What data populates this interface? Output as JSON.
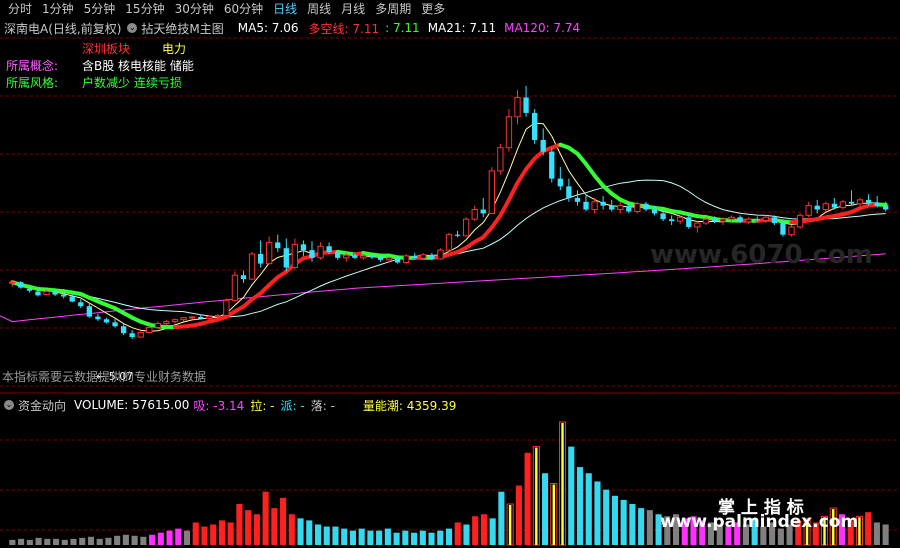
{
  "tabs": [
    {
      "label": "分时",
      "active": false
    },
    {
      "label": "1分钟",
      "active": false
    },
    {
      "label": "5分钟",
      "active": false
    },
    {
      "label": "15分钟",
      "active": false
    },
    {
      "label": "30分钟",
      "active": false
    },
    {
      "label": "60分钟",
      "active": false
    },
    {
      "label": "日线",
      "active": true
    },
    {
      "label": "周线",
      "active": false
    },
    {
      "label": "月线",
      "active": false
    },
    {
      "label": "多周期",
      "active": false
    },
    {
      "label": "更多",
      "active": false
    }
  ],
  "header": {
    "stock": "深南电A(日线,前复权)",
    "indicator": "拈天绝技M主图",
    "ma5": "MA5: 7.06",
    "duokong": "多空线: 7.11",
    "dk2": ": 7.11",
    "ma21": "MA21: 7.11",
    "ma120": "MA120: 7.74"
  },
  "info": {
    "board_value": "深圳板块",
    "industry_value": "电力",
    "concept_label": "所属概念:",
    "concept_value": "含B股 核电核能 储能",
    "style_label": "所属风格:",
    "style_value": "户数减少 连续亏损"
  },
  "notes": {
    "low_price": "← 5.07",
    "cloud_notice": "本指标需要云数据提供的专业财务数据"
  },
  "lower": {
    "name": "资金动向",
    "volume": "VOLUME: 57615.00",
    "xi": "吸: -3.14",
    "la": "拉: -",
    "pai": "派: -",
    "luo": "落: -",
    "liangnengchao": "量能潮: 4359.39"
  },
  "watermarks": {
    "cn": "掌 上 指 标",
    "url": "www.palmindex.com",
    "site": "www.6070.com"
  },
  "colors": {
    "up": "#ff3030",
    "down": "#36e0ff",
    "ma5": "#ffffa0",
    "ma21": "#c0ffff",
    "ma120": "#ff40ff",
    "dk_up": "#ff2020",
    "dk_down": "#33ff33",
    "grid": "#7a0000"
  },
  "chart_data": {
    "type": "candlestick",
    "candles": [
      [
        7.2,
        7.28,
        7.1,
        7.22,
        "up"
      ],
      [
        7.22,
        7.25,
        7.05,
        7.08,
        "down"
      ],
      [
        7.05,
        7.12,
        6.95,
        7.0,
        "down"
      ],
      [
        6.98,
        7.05,
        6.85,
        6.88,
        "down"
      ],
      [
        6.9,
        7.02,
        6.88,
        6.98,
        "up"
      ],
      [
        6.98,
        7.0,
        6.86,
        6.9,
        "down"
      ],
      [
        6.9,
        6.96,
        6.8,
        6.85,
        "down"
      ],
      [
        6.85,
        6.9,
        6.7,
        6.72,
        "down"
      ],
      [
        6.7,
        6.78,
        6.55,
        6.6,
        "down"
      ],
      [
        6.6,
        6.66,
        6.3,
        6.33,
        "down"
      ],
      [
        6.33,
        6.4,
        6.22,
        6.26,
        "down"
      ],
      [
        6.26,
        6.3,
        6.15,
        6.18,
        "down"
      ],
      [
        6.18,
        6.27,
        6.05,
        6.08,
        "down"
      ],
      [
        6.08,
        6.15,
        5.85,
        5.9,
        "down"
      ],
      [
        5.9,
        5.98,
        5.75,
        5.8,
        "down"
      ],
      [
        5.8,
        5.95,
        5.78,
        5.92,
        "up"
      ],
      [
        5.92,
        6.1,
        5.9,
        6.05,
        "up"
      ],
      [
        6.05,
        6.2,
        6.02,
        6.15,
        "up"
      ],
      [
        6.15,
        6.25,
        6.1,
        6.2,
        "up"
      ],
      [
        6.2,
        6.28,
        6.15,
        6.25,
        "up"
      ],
      [
        6.25,
        6.32,
        6.2,
        6.3,
        "up"
      ],
      [
        6.3,
        6.35,
        6.25,
        6.32,
        "up"
      ],
      [
        6.32,
        6.38,
        6.25,
        6.28,
        "down"
      ],
      [
        6.28,
        6.36,
        6.22,
        6.33,
        "up"
      ],
      [
        6.33,
        6.4,
        6.28,
        6.36,
        "up"
      ],
      [
        6.36,
        6.8,
        6.35,
        6.75,
        "up"
      ],
      [
        6.75,
        7.5,
        6.72,
        7.4,
        "up"
      ],
      [
        7.4,
        7.52,
        7.2,
        7.3,
        "down"
      ],
      [
        7.3,
        8.0,
        7.28,
        7.95,
        "up"
      ],
      [
        7.95,
        8.3,
        7.6,
        7.7,
        "down"
      ],
      [
        7.7,
        8.4,
        7.68,
        8.25,
        "up"
      ],
      [
        8.25,
        8.45,
        8.0,
        8.1,
        "down"
      ],
      [
        8.1,
        8.35,
        7.5,
        7.6,
        "down"
      ],
      [
        7.6,
        8.35,
        7.55,
        8.2,
        "up"
      ],
      [
        8.2,
        8.3,
        7.9,
        8.05,
        "down"
      ],
      [
        8.05,
        8.28,
        7.75,
        7.85,
        "down"
      ],
      [
        7.85,
        8.25,
        7.8,
        8.15,
        "up"
      ],
      [
        8.15,
        8.25,
        7.95,
        8.0,
        "down"
      ],
      [
        8.0,
        8.05,
        7.8,
        7.85,
        "down"
      ],
      [
        7.85,
        7.98,
        7.75,
        7.92,
        "up"
      ],
      [
        7.92,
        7.97,
        7.82,
        7.85,
        "down"
      ],
      [
        7.85,
        7.95,
        7.8,
        7.9,
        "up"
      ],
      [
        7.9,
        7.96,
        7.82,
        7.86,
        "down"
      ],
      [
        7.86,
        7.92,
        7.75,
        7.8,
        "down"
      ],
      [
        7.8,
        7.88,
        7.72,
        7.85,
        "up"
      ],
      [
        7.85,
        7.9,
        7.7,
        7.73,
        "down"
      ],
      [
        7.73,
        7.95,
        7.68,
        7.9,
        "up"
      ],
      [
        7.9,
        7.98,
        7.8,
        7.84,
        "down"
      ],
      [
        7.84,
        7.97,
        7.8,
        7.93,
        "up"
      ],
      [
        7.93,
        7.98,
        7.78,
        7.82,
        "down"
      ],
      [
        7.82,
        8.1,
        7.8,
        8.05,
        "up"
      ],
      [
        8.05,
        8.5,
        8.0,
        8.45,
        "up"
      ],
      [
        8.45,
        8.55,
        8.38,
        8.42,
        "down"
      ],
      [
        8.42,
        8.9,
        8.4,
        8.85,
        "up"
      ],
      [
        8.85,
        9.2,
        8.8,
        9.1,
        "up"
      ],
      [
        9.1,
        9.4,
        8.9,
        9.0,
        "down"
      ],
      [
        9.0,
        10.2,
        8.98,
        10.1,
        "up"
      ],
      [
        10.1,
        10.8,
        10.0,
        10.7,
        "up"
      ],
      [
        10.7,
        11.7,
        10.6,
        11.5,
        "up"
      ],
      [
        11.5,
        12.2,
        11.3,
        12.0,
        "up"
      ],
      [
        12.0,
        12.3,
        11.5,
        11.6,
        "down"
      ],
      [
        11.6,
        11.7,
        10.8,
        10.9,
        "down"
      ],
      [
        10.9,
        11.2,
        10.5,
        10.6,
        "down"
      ],
      [
        10.6,
        10.7,
        9.8,
        9.9,
        "down"
      ],
      [
        9.9,
        10.2,
        9.6,
        9.7,
        "down"
      ],
      [
        9.7,
        9.9,
        9.3,
        9.4,
        "down"
      ],
      [
        9.4,
        9.6,
        9.2,
        9.3,
        "down"
      ],
      [
        9.3,
        9.5,
        9.05,
        9.1,
        "down"
      ],
      [
        9.1,
        9.4,
        9.0,
        9.3,
        "up"
      ],
      [
        9.3,
        9.45,
        9.1,
        9.2,
        "down"
      ],
      [
        9.2,
        9.35,
        9.05,
        9.1,
        "down"
      ],
      [
        9.1,
        9.3,
        9.0,
        9.2,
        "up"
      ],
      [
        9.2,
        9.25,
        9.0,
        9.05,
        "down"
      ],
      [
        9.05,
        9.3,
        9.0,
        9.25,
        "up"
      ],
      [
        9.25,
        9.3,
        9.05,
        9.1,
        "down"
      ],
      [
        9.1,
        9.2,
        8.95,
        9.0,
        "down"
      ],
      [
        9.0,
        9.1,
        8.8,
        8.85,
        "down"
      ],
      [
        8.85,
        8.95,
        8.7,
        8.8,
        "down"
      ],
      [
        8.8,
        8.95,
        8.72,
        8.9,
        "up"
      ],
      [
        8.9,
        9.0,
        8.6,
        8.65,
        "down"
      ],
      [
        8.65,
        8.8,
        8.5,
        8.75,
        "up"
      ],
      [
        8.75,
        8.9,
        8.7,
        8.85,
        "up"
      ],
      [
        8.85,
        8.92,
        8.75,
        8.8,
        "down"
      ],
      [
        8.8,
        8.9,
        8.7,
        8.85,
        "up"
      ],
      [
        8.85,
        8.95,
        8.8,
        8.9,
        "up"
      ],
      [
        8.9,
        8.95,
        8.75,
        8.78,
        "down"
      ],
      [
        8.78,
        8.9,
        8.72,
        8.85,
        "up"
      ],
      [
        8.85,
        8.92,
        8.78,
        8.82,
        "down"
      ],
      [
        8.82,
        8.95,
        8.75,
        8.9,
        "up"
      ],
      [
        8.9,
        8.95,
        8.7,
        8.75,
        "down"
      ],
      [
        8.75,
        8.85,
        8.4,
        8.45,
        "down"
      ],
      [
        8.45,
        8.7,
        8.4,
        8.65,
        "up"
      ],
      [
        8.65,
        9.0,
        8.6,
        8.95,
        "up"
      ],
      [
        8.95,
        9.3,
        8.9,
        9.2,
        "up"
      ],
      [
        9.2,
        9.35,
        9.0,
        9.1,
        "down"
      ],
      [
        9.1,
        9.3,
        9.05,
        9.25,
        "up"
      ],
      [
        9.25,
        9.4,
        9.1,
        9.15,
        "down"
      ],
      [
        9.15,
        9.35,
        9.1,
        9.3,
        "up"
      ],
      [
        9.3,
        9.6,
        9.2,
        9.25,
        "down"
      ],
      [
        9.25,
        9.4,
        9.1,
        9.35,
        "up"
      ],
      [
        9.35,
        9.5,
        9.2,
        9.28,
        "down"
      ],
      [
        9.28,
        9.45,
        9.15,
        9.2,
        "down"
      ],
      [
        9.2,
        9.3,
        9.05,
        9.1,
        "down"
      ]
    ],
    "volume": [
      [
        5,
        "gray"
      ],
      [
        6,
        "gray"
      ],
      [
        5,
        "gray"
      ],
      [
        7,
        "gray"
      ],
      [
        6,
        "gray"
      ],
      [
        6,
        "gray"
      ],
      [
        5,
        "gray"
      ],
      [
        6,
        "gray"
      ],
      [
        7,
        "gray"
      ],
      [
        8,
        "gray"
      ],
      [
        6,
        "gray"
      ],
      [
        7,
        "gray"
      ],
      [
        9,
        "gray"
      ],
      [
        10,
        "gray"
      ],
      [
        9,
        "gray"
      ],
      [
        8,
        "gray"
      ],
      [
        10,
        "magenta"
      ],
      [
        12,
        "magenta"
      ],
      [
        14,
        "magenta"
      ],
      [
        16,
        "magenta"
      ],
      [
        14,
        "gray"
      ],
      [
        22,
        "red"
      ],
      [
        18,
        "red"
      ],
      [
        20,
        "red"
      ],
      [
        24,
        "red"
      ],
      [
        22,
        "red"
      ],
      [
        40,
        "red"
      ],
      [
        34,
        "red"
      ],
      [
        30,
        "red"
      ],
      [
        52,
        "red"
      ],
      [
        36,
        "red"
      ],
      [
        46,
        "red"
      ],
      [
        30,
        "red"
      ],
      [
        26,
        "cyan"
      ],
      [
        24,
        "cyan"
      ],
      [
        20,
        "cyan"
      ],
      [
        18,
        "cyan"
      ],
      [
        18,
        "cyan"
      ],
      [
        16,
        "cyan"
      ],
      [
        14,
        "cyan"
      ],
      [
        16,
        "cyan"
      ],
      [
        14,
        "cyan"
      ],
      [
        14,
        "cyan"
      ],
      [
        16,
        "cyan"
      ],
      [
        12,
        "cyan"
      ],
      [
        14,
        "cyan"
      ],
      [
        12,
        "cyan"
      ],
      [
        14,
        "cyan"
      ],
      [
        12,
        "cyan"
      ],
      [
        14,
        "cyan"
      ],
      [
        16,
        "cyan"
      ],
      [
        22,
        "red"
      ],
      [
        20,
        "cyan"
      ],
      [
        28,
        "red"
      ],
      [
        30,
        "red"
      ],
      [
        26,
        "cyan"
      ],
      [
        52,
        "cyan"
      ],
      [
        40,
        "yellow"
      ],
      [
        58,
        "red"
      ],
      [
        90,
        "red"
      ],
      [
        96,
        "yellow"
      ],
      [
        70,
        "cyan"
      ],
      [
        60,
        "yellow"
      ],
      [
        120,
        "yellow"
      ],
      [
        96,
        "cyan"
      ],
      [
        76,
        "cyan"
      ],
      [
        70,
        "cyan"
      ],
      [
        62,
        "cyan"
      ],
      [
        54,
        "cyan"
      ],
      [
        48,
        "cyan"
      ],
      [
        44,
        "cyan"
      ],
      [
        40,
        "cyan"
      ],
      [
        36,
        "cyan"
      ],
      [
        34,
        "gray"
      ],
      [
        30,
        "cyan"
      ],
      [
        28,
        "gray"
      ],
      [
        30,
        "gray"
      ],
      [
        26,
        "magenta"
      ],
      [
        28,
        "magenta"
      ],
      [
        24,
        "magenta"
      ],
      [
        22,
        "gray"
      ],
      [
        20,
        "gray"
      ],
      [
        18,
        "magenta"
      ],
      [
        22,
        "magenta"
      ],
      [
        20,
        "gray"
      ],
      [
        26,
        "cyan"
      ],
      [
        18,
        "gray"
      ],
      [
        22,
        "gray"
      ],
      [
        16,
        "gray"
      ],
      [
        20,
        "gray"
      ],
      [
        24,
        "red"
      ],
      [
        26,
        "yellow"
      ],
      [
        22,
        "red"
      ],
      [
        28,
        "yellow"
      ],
      [
        36,
        "yellow"
      ],
      [
        30,
        "magenta"
      ],
      [
        24,
        "red"
      ],
      [
        28,
        "yellow"
      ],
      [
        32,
        "red"
      ],
      [
        22,
        "gray"
      ],
      [
        20,
        "gray"
      ]
    ]
  }
}
